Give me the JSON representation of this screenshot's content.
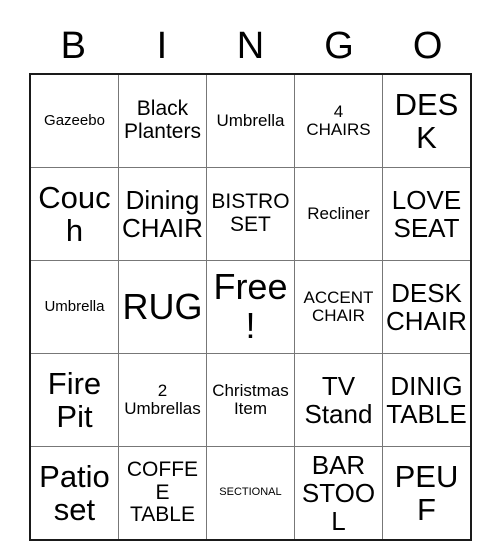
{
  "card": {
    "header_letters": [
      "B",
      "I",
      "N",
      "G",
      "O"
    ],
    "free_space_label": "Free!",
    "rows": [
      [
        {
          "text": "Gazeebo",
          "size": "sm"
        },
        {
          "text": "Black\nPlanters",
          "size": "lg"
        },
        {
          "text": "Umbrella",
          "size": "md"
        },
        {
          "text": "4\nCHAIRS",
          "size": "md"
        },
        {
          "text": "DESK",
          "size": "xxl"
        }
      ],
      [
        {
          "text": "Couch",
          "size": "xxl"
        },
        {
          "text": "Dining\nCHAIR",
          "size": "xl"
        },
        {
          "text": "BISTRO\nSET",
          "size": "lg"
        },
        {
          "text": "Recliner",
          "size": "md"
        },
        {
          "text": "LOVE\nSEAT",
          "size": "xl"
        }
      ],
      [
        {
          "text": "Umbrella",
          "size": "sm"
        },
        {
          "text": "RUG",
          "size": "huge"
        },
        {
          "text": "Free!",
          "size": "huge"
        },
        {
          "text": "ACCENT\nCHAIR",
          "size": "md"
        },
        {
          "text": "DESK\nCHAIR",
          "size": "xl"
        }
      ],
      [
        {
          "text": "Fire\nPit",
          "size": "xxl"
        },
        {
          "text": "2\nUmbrellas",
          "size": "md"
        },
        {
          "text": "Christmas\nItem",
          "size": "md"
        },
        {
          "text": "TV\nStand",
          "size": "xl"
        },
        {
          "text": "DINIG\nTABLE",
          "size": "xl"
        }
      ],
      [
        {
          "text": "Patio\nset",
          "size": "xxl"
        },
        {
          "text": "COFFEE\nTABLE",
          "size": "lg"
        },
        {
          "text": "SECTIONAL",
          "size": "xs"
        },
        {
          "text": "BAR\nSTOOL",
          "size": "xl"
        },
        {
          "text": "PEUF",
          "size": "xxl"
        }
      ]
    ]
  },
  "colors": {
    "background": "#ffffff",
    "text": "#000000",
    "outer_border": "#1a1a1a",
    "inner_border": "#777777"
  }
}
